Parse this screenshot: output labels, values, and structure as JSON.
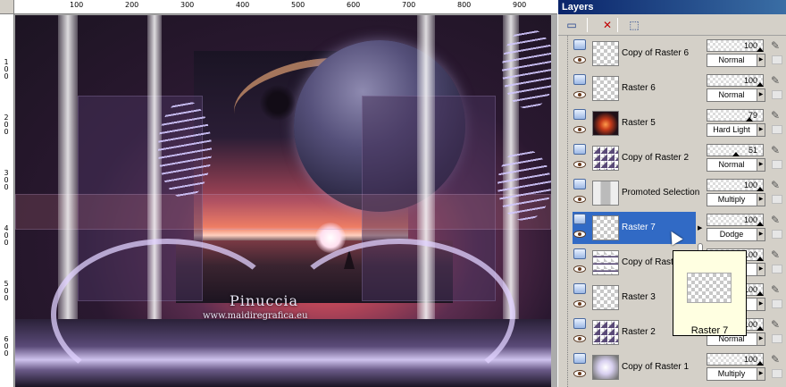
{
  "rulers": {
    "top_marks": [
      "100",
      "200",
      "300",
      "400",
      "500",
      "600",
      "700",
      "800",
      "900"
    ],
    "left_marks": [
      "100",
      "200",
      "300",
      "400",
      "500",
      "600"
    ]
  },
  "artwork": {
    "signature_name": "Pinuccia",
    "signature_url": "www.maidiregrafica.eu"
  },
  "palette": {
    "title": "Layers",
    "toolbar": [
      {
        "name": "new-layer-icon",
        "glyph": "▭"
      },
      {
        "name": "delete-layer-icon",
        "glyph": "✕"
      },
      {
        "name": "edit-selection-icon",
        "glyph": "⬚"
      }
    ],
    "layers": [
      {
        "name": "Copy of Raster 6",
        "opacity": "100",
        "blend": "Normal",
        "selected": false,
        "thumb": "checker"
      },
      {
        "name": "Raster 6",
        "opacity": "100",
        "blend": "Normal",
        "selected": false,
        "thumb": "checker"
      },
      {
        "name": "Raster 5",
        "opacity": "79",
        "blend": "Hard Light",
        "selected": false,
        "thumb": "sunset"
      },
      {
        "name": "Copy of Raster 2",
        "opacity": "51",
        "blend": "Normal",
        "selected": false,
        "thumb": "triangle"
      },
      {
        "name": "Promoted Selection",
        "opacity": "100",
        "blend": "Multiply",
        "selected": false,
        "thumb": "bars"
      },
      {
        "name": "Raster 7",
        "opacity": "100",
        "blend": "Dodge",
        "selected": true,
        "thumb": "checker"
      },
      {
        "name": "Copy of Raster",
        "opacity": "100",
        "blend": "",
        "selected": false,
        "thumb": "strip"
      },
      {
        "name": "Raster 3",
        "opacity": "100",
        "blend": "",
        "selected": false,
        "thumb": "checker"
      },
      {
        "name": "Raster 2",
        "opacity": "100",
        "blend": "Normal",
        "selected": false,
        "thumb": "triangle"
      },
      {
        "name": "Copy of Raster 1",
        "opacity": "100",
        "blend": "Multiply",
        "selected": false,
        "thumb": "glow"
      }
    ],
    "tooltip_label": "Raster 7"
  }
}
